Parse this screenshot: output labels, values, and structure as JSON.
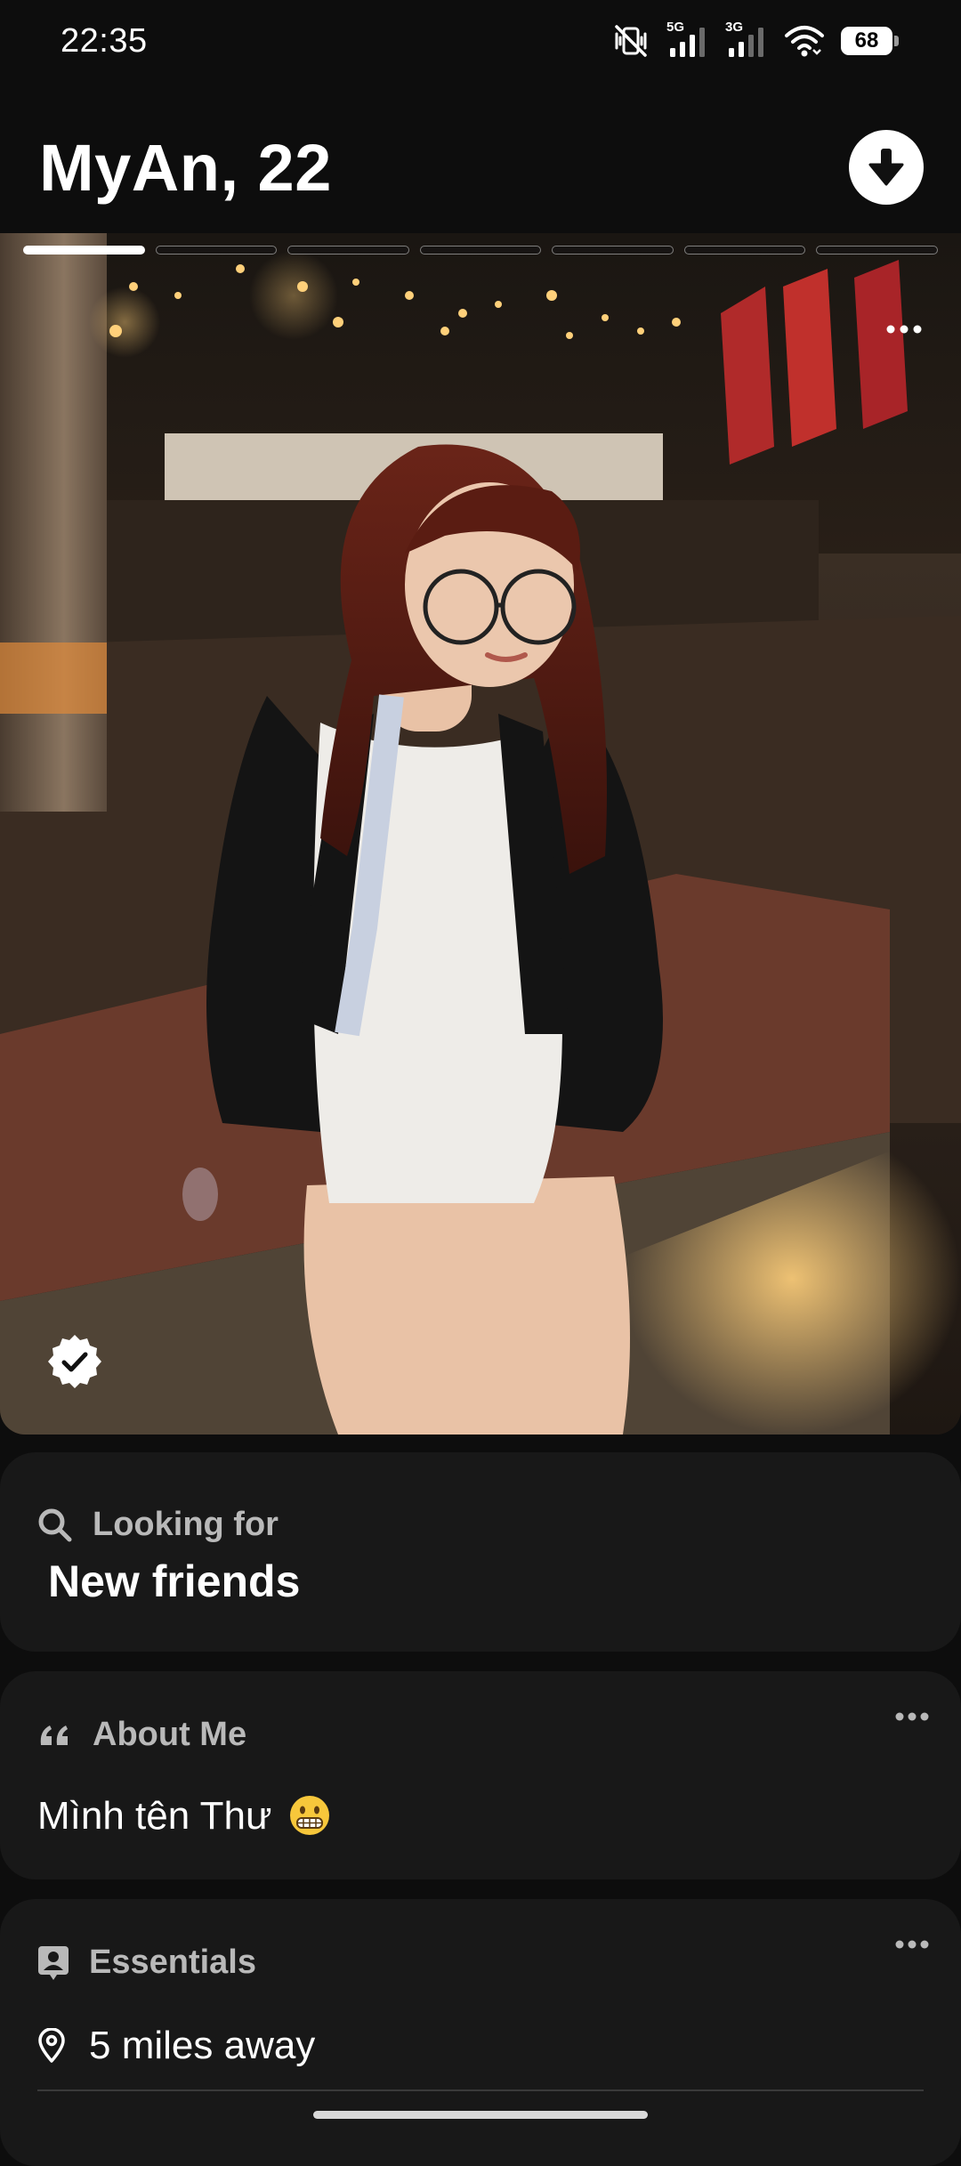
{
  "status_bar": {
    "time": "22:35",
    "network_1": "5G",
    "network_2": "3G",
    "battery": "68",
    "icons": [
      "mute-vibrate-icon",
      "signal-5g-icon",
      "signal-3g-icon",
      "wifi-icon",
      "battery-icon"
    ]
  },
  "profile": {
    "name_age": "MyAn, 22",
    "photo_count": 7,
    "active_photo": 1,
    "verified": true
  },
  "looking_for": {
    "label": "Looking for",
    "value": "New friends",
    "icon": "search-icon"
  },
  "about_me": {
    "label": "About Me",
    "text": "Mình tên Thư",
    "emoji": "grimacing-face",
    "icon": "quote-icon"
  },
  "essentials": {
    "label": "Essentials",
    "distance": "5 miles away",
    "icon": "profile-card-icon",
    "distance_icon": "location-pin-icon"
  },
  "colors": {
    "background": "#0d0d0d",
    "card": "#181818",
    "label_gray": "#b9b9b9",
    "text": "#ffffff"
  }
}
